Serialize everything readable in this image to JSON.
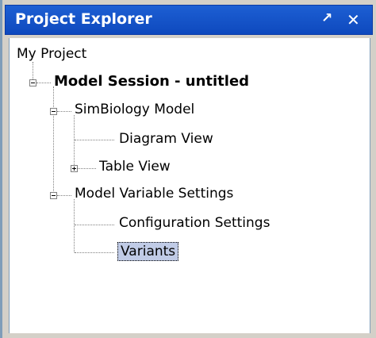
{
  "panel": {
    "title": "Project Explorer",
    "pin_symbol": "↗",
    "close_symbol": "✕"
  },
  "tree": {
    "root": "My Project",
    "session": "Model Session - untitled",
    "model": "SimBiology Model",
    "diagram_view": "Diagram View",
    "table_view": "Table View",
    "variable_settings": "Model Variable Settings",
    "configuration_settings": "Configuration Settings",
    "variants": "Variants"
  },
  "colors": {
    "titlebar": "#1a5ccf",
    "selection": "#c0cbe6"
  }
}
